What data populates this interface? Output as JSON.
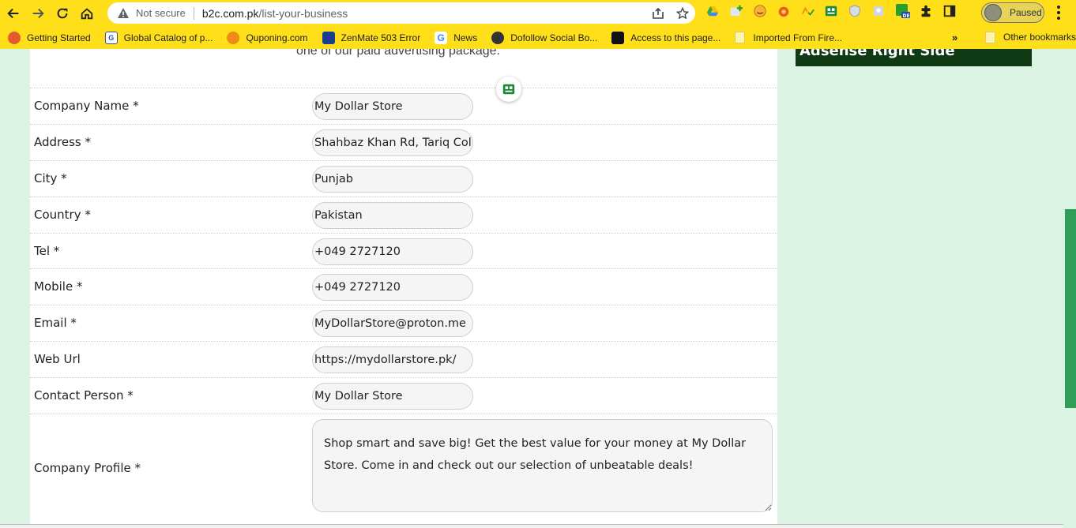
{
  "browser": {
    "security_label": "Not secure",
    "url_host": "b2c.com.pk",
    "url_path": "/list-your-business",
    "profile_label": "Paused"
  },
  "bookmarks": {
    "items": [
      {
        "label": "Getting Started",
        "icon": "firefox-icon",
        "color": "#e55b2b"
      },
      {
        "label": "Global Catalog of p...",
        "icon": "gc-icon",
        "color": "#2a4fb5"
      },
      {
        "label": "Quponing.com",
        "icon": "quponing-icon",
        "color": "#f08a16"
      },
      {
        "label": "ZenMate 503 Error",
        "icon": "zenmate-icon",
        "color": "#1d3b8f"
      },
      {
        "label": "News",
        "icon": "google-icon",
        "color": "#4285f4"
      },
      {
        "label": "Dofollow Social Bo...",
        "icon": "globe-icon",
        "color": "#333333"
      },
      {
        "label": "Access to this page...",
        "icon": "black-square-icon",
        "color": "#111111"
      },
      {
        "label": "Imported From Fire...",
        "icon": "folder-icon",
        "color": "#fff3b0"
      }
    ],
    "more": "»",
    "other": "Other bookmarks"
  },
  "page": {
    "cutoff_text": "one of our paid advertising package.",
    "ad_label": "Adsense Right Side"
  },
  "form": {
    "company_name": {
      "label": "Company Name *",
      "value": "My Dollar Store"
    },
    "address": {
      "label": "Address *",
      "value": "Shahbaz Khan Rd, Tariq Colony"
    },
    "city": {
      "label": "City *",
      "value": "Punjab"
    },
    "country": {
      "label": "Country *",
      "value": "Pakistan"
    },
    "tel": {
      "label": "Tel *",
      "value": "+049 2727120"
    },
    "mobile": {
      "label": "Mobile *",
      "value": "+049 2727120"
    },
    "email": {
      "label": "Email *",
      "value": "MyDollarStore@proton.me"
    },
    "web_url": {
      "label": "Web Url",
      "value": "https://mydollarstore.pk/"
    },
    "contact_person": {
      "label": "Contact Person *",
      "value": "My Dollar Store"
    },
    "company_profile": {
      "label": "Company Profile *",
      "value": "Shop smart and save big! Get the best value for your money at My Dollar Store. Come in and check out our selection of unbeatable deals!"
    }
  },
  "colors": {
    "chrome": "#ffde1a",
    "page_bg": "#dbf3e3",
    "ad_bg": "#0f3a13",
    "scrollbar": "#2e9e5a"
  }
}
